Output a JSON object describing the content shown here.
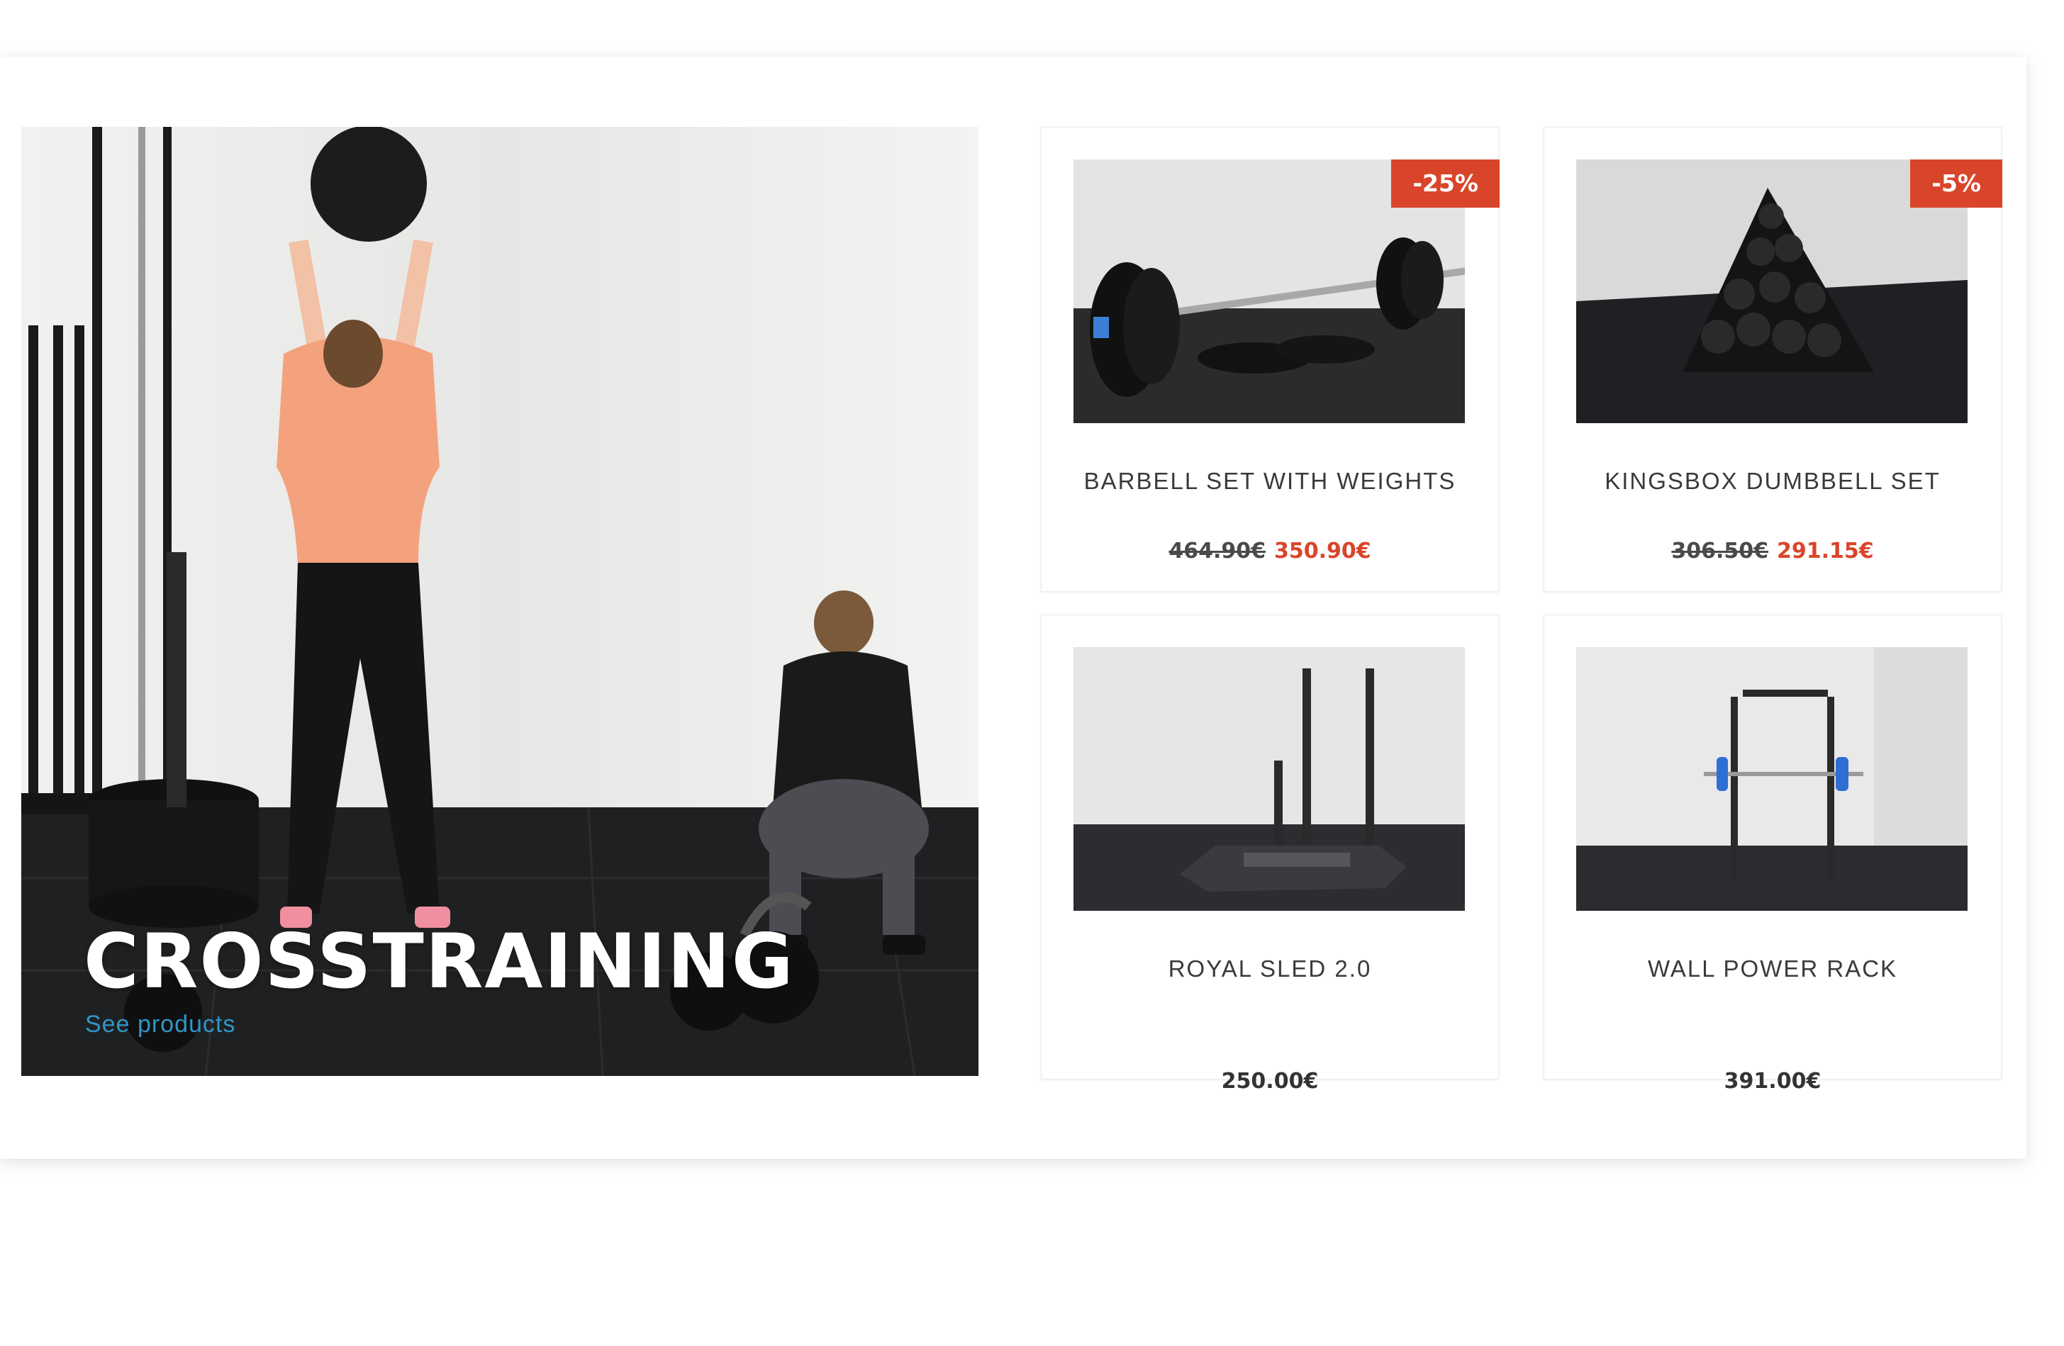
{
  "banner": {
    "title": "CROSSTRAINING",
    "link_label": "See products"
  },
  "colors": {
    "accent": "#d9452a",
    "link": "#2f96c9",
    "text": "#3a3a3a"
  },
  "products": [
    {
      "name": "BARBELL SET WITH WEIGHTS",
      "badge": "-25%",
      "old_price": "464.90€",
      "price": "350.90€",
      "image_icon": "barbell-image"
    },
    {
      "name": "KINGSBOX DUMBBELL SET",
      "badge": "-5%",
      "old_price": "306.50€",
      "price": "291.15€",
      "image_icon": "dumbbells-image"
    },
    {
      "name": "ROYAL SLED 2.0",
      "price": "250.00€",
      "image_icon": "sled-image"
    },
    {
      "name": "WALL POWER RACK",
      "price": "391.00€",
      "image_icon": "power-rack-image"
    }
  ]
}
